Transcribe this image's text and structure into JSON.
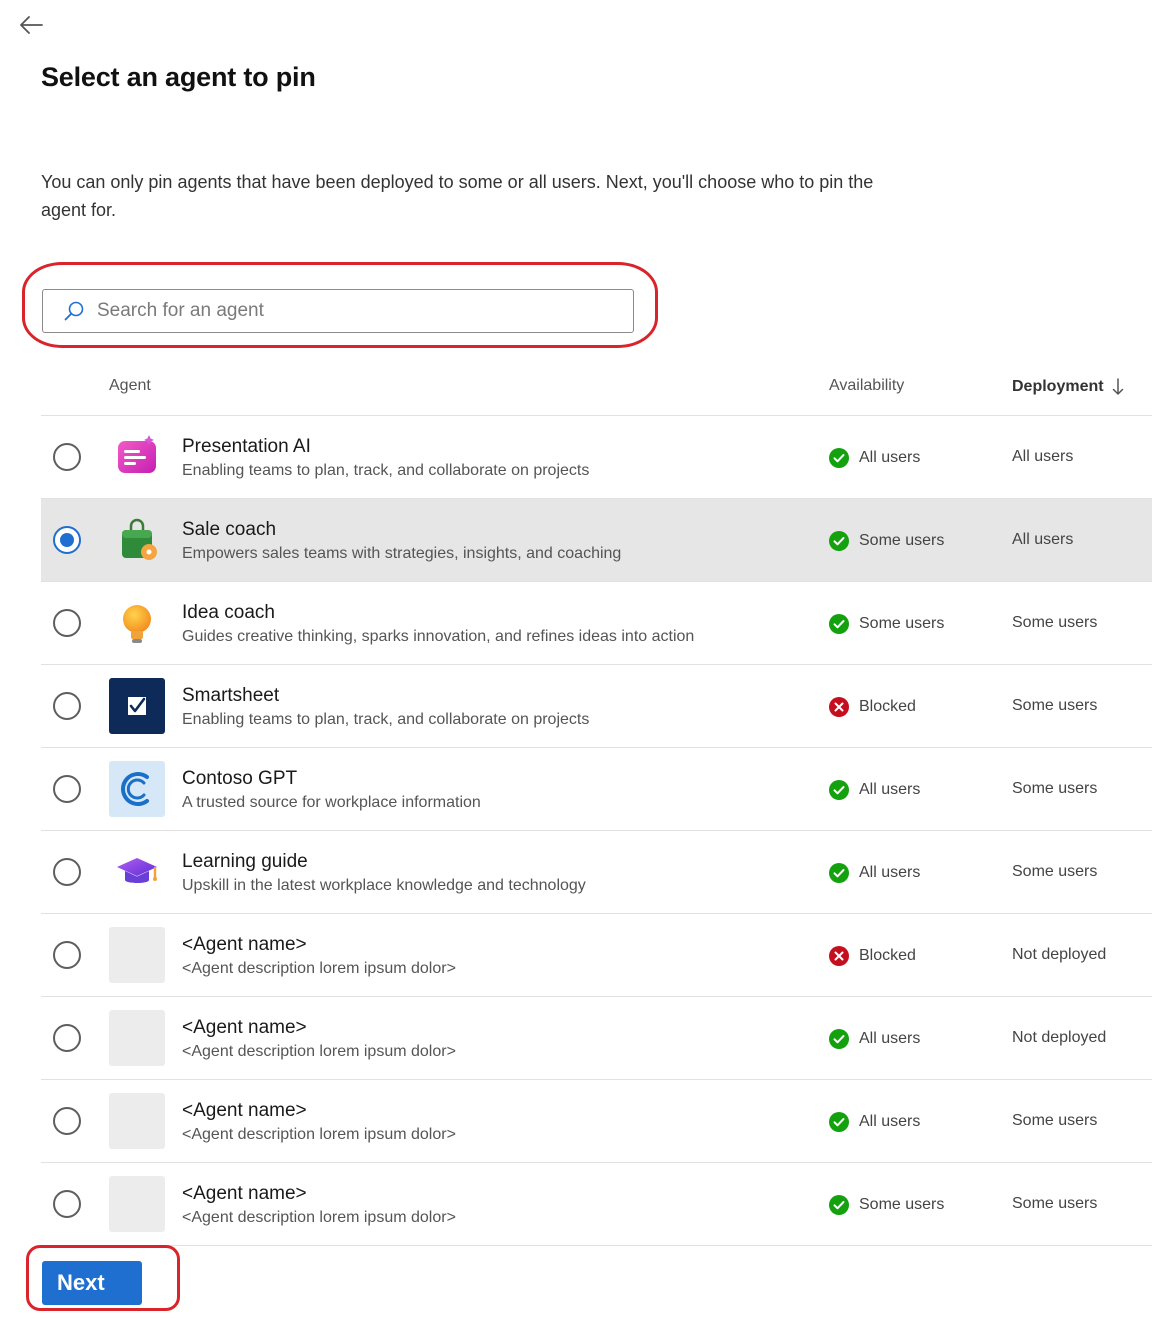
{
  "page": {
    "title": "Select an agent to pin",
    "description": "You can only pin agents that have been deployed to some or all users. Next, you'll choose who to pin the agent for."
  },
  "search": {
    "placeholder": "Search for an agent"
  },
  "table": {
    "headers": {
      "agent": "Agent",
      "availability": "Availability",
      "deployment": "Deployment"
    },
    "sort": {
      "column": "deployment",
      "direction": "descending"
    },
    "rows": [
      {
        "name": "Presentation AI",
        "description": "Enabling teams to plan, track, and collaborate on projects",
        "availability": "All users",
        "availability_status": "ok",
        "deployment": "All users",
        "selected": false,
        "icon": "presentation-ai-icon"
      },
      {
        "name": "Sale coach",
        "description": "Empowers sales teams with strategies, insights, and coaching",
        "availability": "Some users",
        "availability_status": "ok",
        "deployment": "All users",
        "selected": true,
        "icon": "sale-coach-icon"
      },
      {
        "name": "Idea coach",
        "description": "Guides creative thinking, sparks innovation, and refines ideas into action",
        "availability": "Some users",
        "availability_status": "ok",
        "deployment": "Some users",
        "selected": false,
        "icon": "idea-coach-icon"
      },
      {
        "name": "Smartsheet",
        "description": "Enabling teams to plan, track, and collaborate on projects",
        "availability": "Blocked",
        "availability_status": "blocked",
        "deployment": "Some users",
        "selected": false,
        "icon": "smartsheet-icon"
      },
      {
        "name": "Contoso GPT",
        "description": "A trusted source for workplace information",
        "availability": "All users",
        "availability_status": "ok",
        "deployment": "Some users",
        "selected": false,
        "icon": "contoso-gpt-icon"
      },
      {
        "name": "Learning guide",
        "description": "Upskill in the latest workplace knowledge and technology",
        "availability": "All users",
        "availability_status": "ok",
        "deployment": "Some users",
        "selected": false,
        "icon": "learning-guide-icon"
      },
      {
        "name": "<Agent name>",
        "description": "<Agent description lorem ipsum dolor>",
        "availability": "Blocked",
        "availability_status": "blocked",
        "deployment": "Not deployed",
        "selected": false,
        "icon": "placeholder-icon"
      },
      {
        "name": "<Agent name>",
        "description": "<Agent description lorem ipsum dolor>",
        "availability": "All users",
        "availability_status": "ok",
        "deployment": "Not deployed",
        "selected": false,
        "icon": "placeholder-icon"
      },
      {
        "name": "<Agent name>",
        "description": "<Agent description lorem ipsum dolor>",
        "availability": "All users",
        "availability_status": "ok",
        "deployment": "Some users",
        "selected": false,
        "icon": "placeholder-icon"
      },
      {
        "name": "<Agent name>",
        "description": "<Agent description lorem ipsum dolor>",
        "availability": "Some users",
        "availability_status": "ok",
        "deployment": "Some users",
        "selected": false,
        "icon": "placeholder-icon"
      }
    ]
  },
  "actions": {
    "next_label": "Next"
  },
  "colors": {
    "accent": "#1f6fd0",
    "success": "#13a10e",
    "blocked": "#c50f1f",
    "highlight_outline": "#d9242b",
    "selected_row": "#e6e6e6"
  }
}
